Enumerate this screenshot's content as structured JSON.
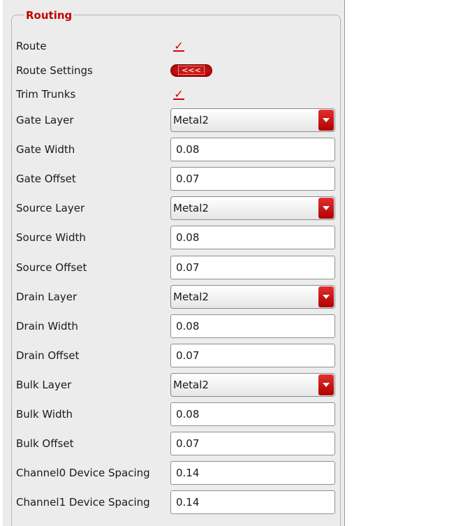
{
  "group": {
    "title": "Routing"
  },
  "rows": {
    "route": {
      "label": "Route",
      "checked": true
    },
    "route_settings": {
      "label": "Route Settings",
      "button": "<<<"
    },
    "trim_trunks": {
      "label": "Trim Trunks",
      "checked": true
    },
    "gate_layer": {
      "label": "Gate Layer",
      "value": "Metal2"
    },
    "gate_width": {
      "label": "Gate Width",
      "value": "0.08"
    },
    "gate_offset": {
      "label": "Gate Offset",
      "value": "0.07"
    },
    "source_layer": {
      "label": "Source Layer",
      "value": "Metal2"
    },
    "source_width": {
      "label": "Source Width",
      "value": "0.08"
    },
    "source_offset": {
      "label": "Source Offset",
      "value": "0.07"
    },
    "drain_layer": {
      "label": "Drain Layer",
      "value": "Metal2"
    },
    "drain_width": {
      "label": "Drain Width",
      "value": "0.08"
    },
    "drain_offset": {
      "label": "Drain Offset",
      "value": "0.07"
    },
    "bulk_layer": {
      "label": "Bulk Layer",
      "value": "Metal2"
    },
    "bulk_width": {
      "label": "Bulk Width",
      "value": "0.08"
    },
    "bulk_offset": {
      "label": "Bulk Offset",
      "value": "0.07"
    },
    "channel0_spacing": {
      "label": "Channel0 Device Spacing",
      "value": "0.14"
    },
    "channel1_spacing": {
      "label": "Channel1 Device Spacing",
      "value": "0.14"
    }
  },
  "colors": {
    "accent": "#c00000",
    "panel_bg": "#ececec"
  },
  "icons": {
    "checkbox": "checkmark-icon",
    "dropdown": "chevron-down-icon"
  }
}
